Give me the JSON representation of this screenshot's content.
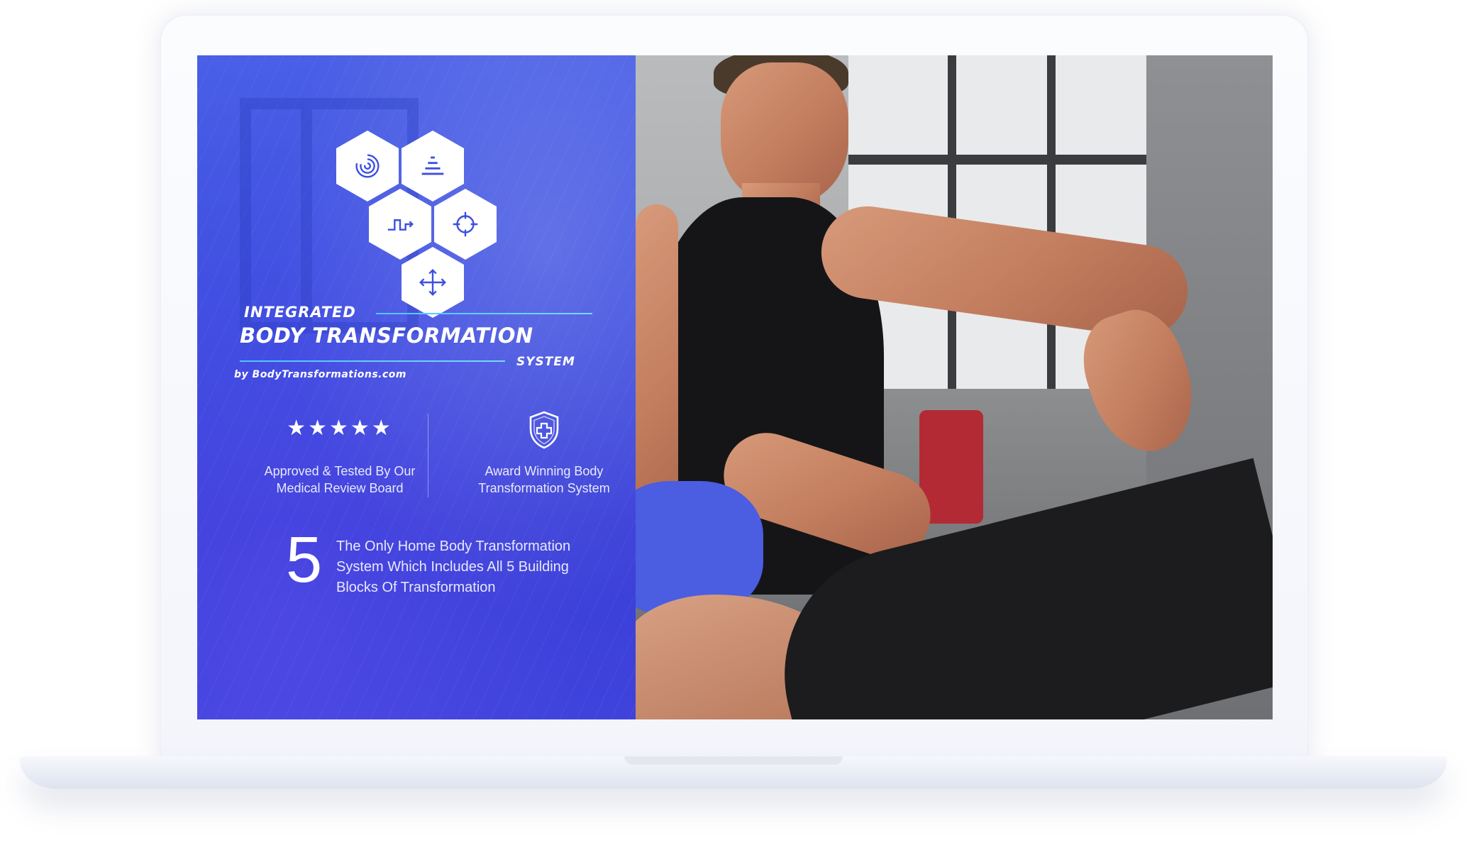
{
  "logo": {
    "line1": "INTEGRATED",
    "line2": "BODY TRANSFORMATION",
    "line3": "SYSTEM",
    "byline": "by BodyTransformations.com",
    "hexagon_icons": [
      "spiral-icon",
      "pyramid-icon",
      "step-chart-icon",
      "target-icon",
      "move-arrows-icon"
    ]
  },
  "features": [
    {
      "icon": "five-stars",
      "stars": "★★★★★",
      "text": "Approved & Tested By Our Medical Review Board"
    },
    {
      "icon": "shield-plus-icon",
      "text": "Award Winning Body Transformation System"
    }
  ],
  "highlight": {
    "number": "5",
    "text": "The Only Home Body Transformation System Which Includes All 5 Building Blocks Of Transformation"
  },
  "colors": {
    "panel_blue": "#3d4fe0",
    "accent_cyan": "#4fc4ff",
    "icon_blue": "#3d4fe0"
  }
}
